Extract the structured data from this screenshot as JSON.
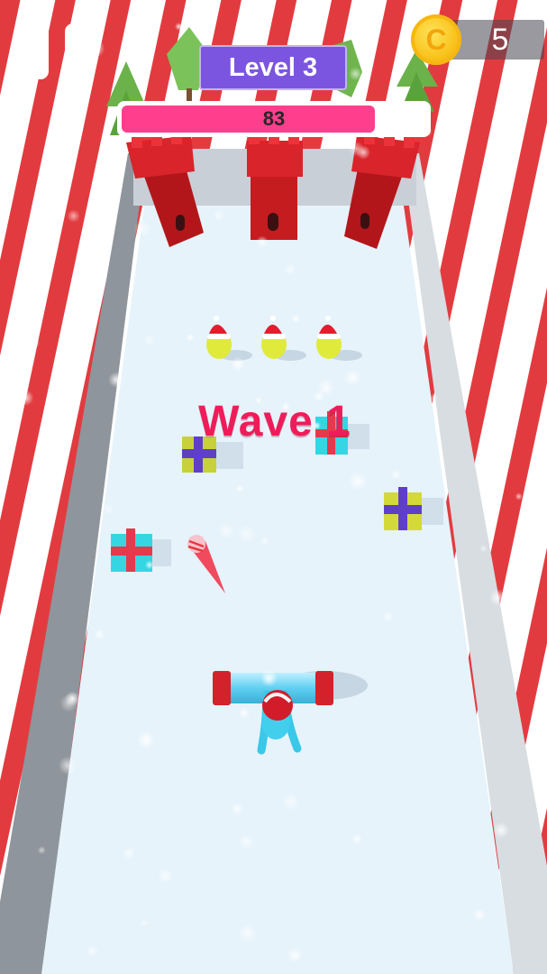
{
  "hud": {
    "level_label": "Level 3",
    "progress_value": "83",
    "progress_fraction": 0.83,
    "coin_count": "5"
  },
  "wave": {
    "label": "Wave 1"
  },
  "icons": {
    "pause": "pause-icon",
    "coin": "coin-icon",
    "coin_glyph": "C"
  },
  "colors": {
    "stripe_red": "#e23b3f",
    "snow_floor": "#e6f3fb",
    "tower_red": "#cc1a1d",
    "level_badge": "#7b55e0",
    "progress_fill": "#ff3f8e",
    "wave_text": "#ee1d5a",
    "coin_gold": "#f8c21a"
  }
}
